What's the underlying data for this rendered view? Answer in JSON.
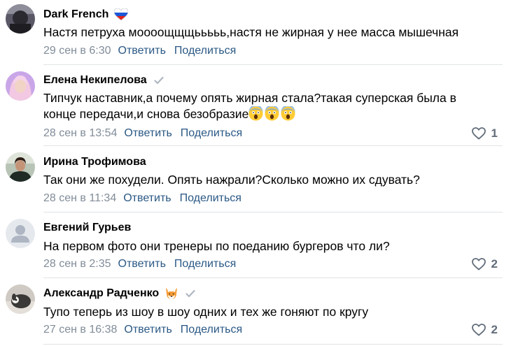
{
  "comments": [
    {
      "author": "Dark French",
      "badge": "russia-flag-heart",
      "text_lines": [
        "Настя петруха мoooощщщььььь,настя не жирная у нее масса мышечная"
      ],
      "date": "29 сен в 6:30",
      "reply_label": "Ответить",
      "share_label": "Поделиться",
      "likes": ""
    },
    {
      "author": "Елена Некипелова",
      "badge": "verified-check",
      "text_lines": [
        "Типчук наставник,а почему опять жирная стала?такая суперская была в",
        "конце передачи,и снова безобразие"
      ],
      "emoji": [
        "screaming-face",
        "screaming-face",
        "screaming-face"
      ],
      "date": "28 сен в 13:54",
      "reply_label": "Ответить",
      "share_label": "Поделиться",
      "likes": "1"
    },
    {
      "author": "Ирина Трофимова",
      "text_lines": [
        "Так они же похудели. Опять нажрали?Сколько можно их сдувать?"
      ],
      "date": "28 сен в 11:34",
      "reply_label": "Ответить",
      "share_label": "Поделиться",
      "likes": ""
    },
    {
      "author": "Евгений Гурьев",
      "text_lines": [
        "На первом фото они тренеры по поеданию бургеров что ли?"
      ],
      "date": "28 сен в 2:35",
      "reply_label": "Ответить",
      "share_label": "Поделиться",
      "likes": "2"
    },
    {
      "author": "Александр Радченко",
      "badge": "fox-emoji",
      "badge2": "verified-check",
      "text_lines": [
        "Тупо теперь из шоу в шоу одних и тех же гоняют по кругу"
      ],
      "date": "27 сен в 16:38",
      "reply_label": "Ответить",
      "share_label": "Поделиться",
      "likes": "2"
    }
  ],
  "colors": {
    "link": "#2a5885",
    "meta": "#818c99",
    "like": "#626d7a",
    "divider": "#e1e3e6"
  }
}
